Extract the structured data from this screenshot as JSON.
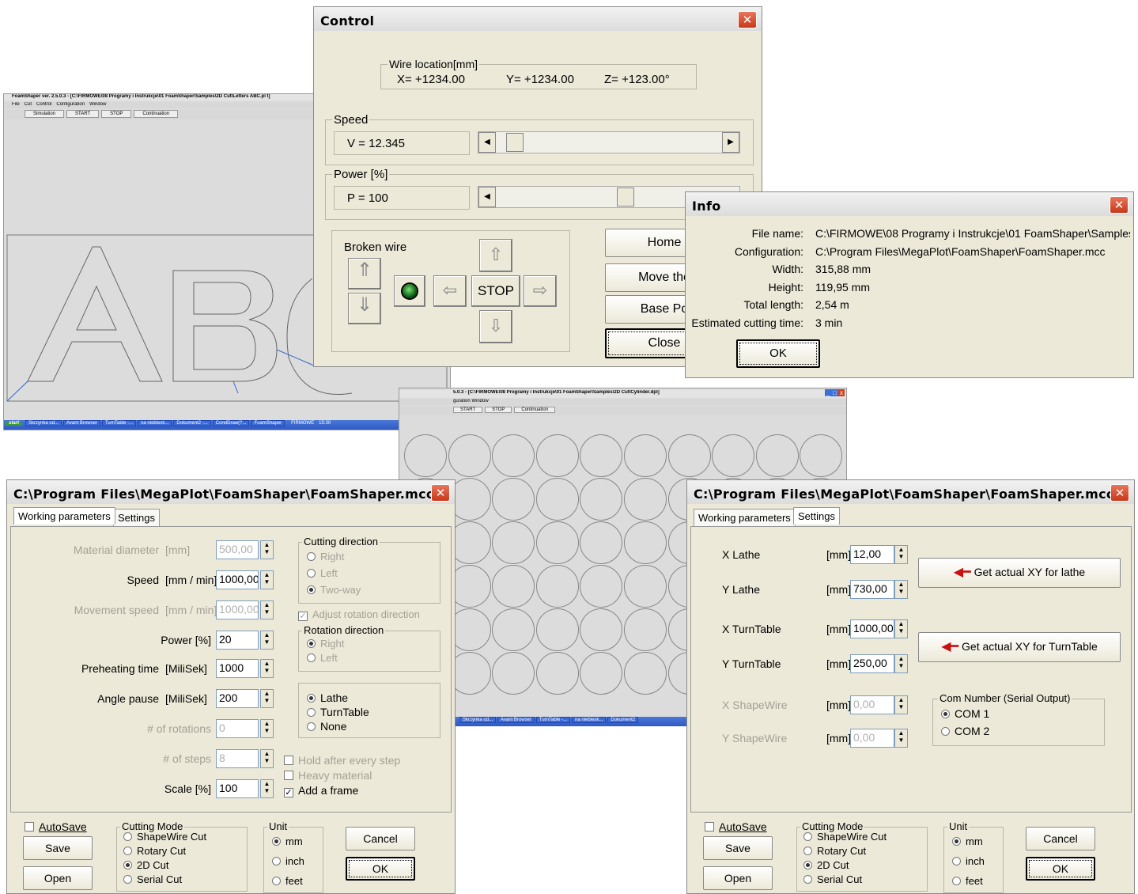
{
  "bg_cad": {
    "title": "FoamShaper ver. 2.5.0.3 - [C:\\FIRMOWE\\08 Programy i Instrukcje\\01 FoamShaper\\Samples\\2D Cut\\Letters ABC.pl t]",
    "menu": [
      "File",
      "Cut",
      "Control",
      "Configuration",
      "Window"
    ],
    "toolbar": [
      "Simulation",
      "START",
      "STOP",
      "Continuation"
    ],
    "taskbar": {
      "start": "start",
      "items": [
        "Skrzynka od...",
        "Avant Browser",
        "TurnTable -...",
        "na niebiesk...",
        "Dokument2 -...",
        "CorelDraw(?...",
        "FoamShaper"
      ],
      "tray": "FIRMOWE",
      "clock": "15:30"
    }
  },
  "bg_cad2": {
    "title": "5.0.3 - [C:\\FIRMOWE\\08 Programy i Instrukcje\\01 FoamShaper\\Samples\\2D Cut\\Cylinder.dpl]",
    "menu": "guration  Window",
    "toolbar": [
      "START",
      "STOP",
      "Continuation"
    ],
    "taskbar": [
      "Skrzynka od...",
      "Avant Browser",
      "TurnTable -...",
      "na niebiesk...",
      "Dokument2"
    ]
  },
  "control": {
    "title": "Control",
    "wire_location": {
      "legend": "Wire location[mm]",
      "x": "X= +1234.00",
      "y": "Y= +1234.00",
      "z": "Z= +123.00°"
    },
    "speed": {
      "legend": "Speed",
      "value": "V =  12.345",
      "level": 0.05
    },
    "power": {
      "legend": "Power [%]",
      "value": "P =  100",
      "level": 0.5
    },
    "jog": {
      "legend": "Broken wire",
      "stop": "STOP"
    },
    "buttons": {
      "home": "Home",
      "move": "Move the",
      "base": "Base Po",
      "close": "Close"
    }
  },
  "info": {
    "title": "Info",
    "rows": [
      {
        "label": "File name:",
        "value": "C:\\FIRMOWE\\08 Programy i Instrukcje\\01 FoamShaper\\Samples\\"
      },
      {
        "label": "Configuration:",
        "value": "C:\\Program Files\\MegaPlot\\FoamShaper\\FoamShaper.mcc"
      },
      {
        "label": "Width:",
        "value": "315,88 mm"
      },
      {
        "label": "Height:",
        "value": "119,95 mm"
      },
      {
        "label": "Total length:",
        "value": "2,54 m"
      },
      {
        "label": "Estimated cutting time:",
        "value": "3 min"
      }
    ],
    "ok": "OK"
  },
  "cfg_left": {
    "title": "C:\\Program Files\\MegaPlot\\FoamShaper\\FoamShaper.mcc",
    "tabs": [
      "Working parameters",
      "Settings"
    ],
    "params": [
      {
        "label": "Material diameter",
        "unit": "[mm]",
        "value": "500,00",
        "disabled": true
      },
      {
        "label": "Speed",
        "unit": "[mm / min]",
        "value": "1000,00",
        "disabled": false
      },
      {
        "label": "Movement speed",
        "unit": "[mm / min]",
        "value": "1000,00",
        "disabled": true
      },
      {
        "label": "Power [%]",
        "unit": "",
        "value": "20",
        "disabled": false
      },
      {
        "label": "Preheating time",
        "unit": "[MiliSek]",
        "value": "1000",
        "disabled": false
      },
      {
        "label": "Angle pause",
        "unit": "[MiliSek]",
        "value": "200",
        "disabled": false
      },
      {
        "label": "# of rotations",
        "unit": "",
        "value": "0",
        "disabled": true
      },
      {
        "label": "# of steps",
        "unit": "",
        "value": "8",
        "disabled": true
      },
      {
        "label": "Scale [%]",
        "unit": "",
        "value": "100",
        "disabled": false
      }
    ],
    "cutting_direction": {
      "legend": "Cutting direction",
      "options": [
        "Right",
        "Left",
        "Two-way"
      ],
      "selected": 2
    },
    "adjust_rotation": "Adjust rotation direction",
    "rotation_direction": {
      "legend": "Rotation direction",
      "options": [
        "Right",
        "Left"
      ],
      "selected": 0
    },
    "machine": {
      "options": [
        "Lathe",
        "TurnTable",
        "None"
      ],
      "selected": 0
    },
    "checks": [
      {
        "label": "Hold after every step",
        "checked": false,
        "disabled": true
      },
      {
        "label": "Heavy material",
        "checked": false,
        "disabled": true
      },
      {
        "label": "Add a frame",
        "checked": true,
        "disabled": false
      }
    ]
  },
  "cfg_right": {
    "title": "C:\\Program Files\\MegaPlot\\FoamShaper\\FoamShaper.mcc",
    "tabs": [
      "Working parameters",
      "Settings"
    ],
    "fields": [
      {
        "label": "X Lathe",
        "unit": "[mm]",
        "value": "12,00",
        "disabled": false
      },
      {
        "label": "Y Lathe",
        "unit": "[mm]",
        "value": "730,00",
        "disabled": false
      },
      {
        "label": "X TurnTable",
        "unit": "[mm]",
        "value": "1000,00",
        "disabled": false
      },
      {
        "label": "Y TurnTable",
        "unit": "[mm]",
        "value": "250,00",
        "disabled": false
      },
      {
        "label": "X ShapeWire",
        "unit": "[mm]",
        "value": "0,00",
        "disabled": true
      },
      {
        "label": "Y ShapeWire",
        "unit": "[mm]",
        "value": "0,00",
        "disabled": true
      }
    ],
    "get_lathe": "Get actual XY for lathe",
    "get_turntable": "Get actual XY for TurnTable",
    "com": {
      "legend": "Com Number (Serial Output)",
      "options": [
        "COM 1",
        "COM 2"
      ],
      "selected": 0
    }
  },
  "footer": {
    "autosave": "AutoSave",
    "save": "Save",
    "open": "Open",
    "cutting_mode": {
      "legend": "Cutting Mode",
      "options": [
        "ShapeWire Cut",
        "Rotary Cut",
        "2D Cut",
        "Serial Cut"
      ],
      "selected": 2
    },
    "unit": {
      "legend": "Unit",
      "options": [
        "mm",
        "inch",
        "feet"
      ],
      "selected": 0
    },
    "cancel": "Cancel",
    "ok": "OK"
  }
}
